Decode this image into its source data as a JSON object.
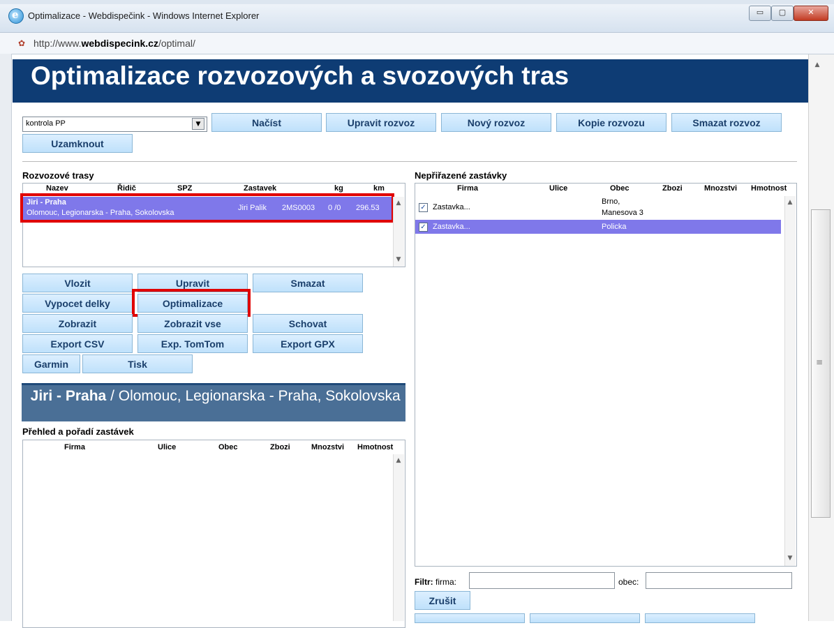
{
  "window": {
    "title": "Optimalizace - Webdispečink - Windows Internet Explorer",
    "min_glyph": "▭",
    "max_glyph": "▢",
    "close_glyph": "✕",
    "url_prefix": "http://www.",
    "url_domain": "webdispecink.cz",
    "url_path": "/optimal/"
  },
  "header": {
    "title": "Optimalizace rozvozových a svozových tras"
  },
  "toolbar": {
    "select_value": "kontrola PP",
    "buttons": [
      "Načíst",
      "Upravit rozvoz",
      "Nový rozvoz",
      "Kopie rozvozu",
      "Smazat rozvoz"
    ],
    "lock_label": "Uzamknout"
  },
  "routes": {
    "section_title": "Rozvozové trasy",
    "columns": [
      "Nazev",
      "Řidič",
      "SPZ",
      "Zastavek",
      "kg",
      "km"
    ],
    "rows": [
      {
        "name": "Jiri - Praha",
        "description": "Olomouc, Legionarska - Praha, Sokolovska",
        "driver": "Jiri Palik",
        "spz": "2MS0003",
        "stops": "0 /0",
        "km": "296.53"
      }
    ]
  },
  "actions": {
    "vlozit": "Vlozit",
    "upravit": "Upravit",
    "smazat": "Smazat",
    "vypocet": "Vypocet delky",
    "optimalizace": "Optimalizace",
    "zobrazit": "Zobrazit",
    "zobrazit_vse": "Zobrazit vse",
    "schovat": "Schovat",
    "export_csv": "Export CSV",
    "export_tomtom": "Exp. TomTom",
    "export_gpx": "Export GPX",
    "garmin": "Garmin",
    "tisk": "Tisk"
  },
  "route_detail": {
    "name": "Jiri - Praha",
    "separator": " / ",
    "description": "Olomouc, Legionarska - Praha, Sokolovska"
  },
  "stops_overview": {
    "title": "Přehled a pořadí zastávek",
    "columns": [
      "Firma",
      "Ulice",
      "Obec",
      "Zbozi",
      "Mnozstvi",
      "Hmotnost"
    ]
  },
  "unassigned": {
    "title": "Nepřiřazené zastávky",
    "columns": [
      "Firma",
      "Ulice",
      "Obec",
      "Zbozi",
      "Mnozstvi",
      "Hmotnost"
    ],
    "rows": [
      {
        "firma": "Zastavka...",
        "obec_line1": "Brno,",
        "obec_line2": "Manesova 3",
        "checked": true
      },
      {
        "firma": "Zastavka...",
        "obec_line1": "Policka",
        "obec_line2": "",
        "checked": true
      }
    ]
  },
  "filter": {
    "label": "Filtr:",
    "firma_label": "firma:",
    "obec_label": "obec:",
    "firma_value": "",
    "obec_value": "",
    "cancel_label": "Zrušit"
  },
  "colors": {
    "banner": "#0e3c74",
    "selected_row": "#7f78ea",
    "highlight": "#e00000",
    "button_text": "#1a3f6b"
  }
}
